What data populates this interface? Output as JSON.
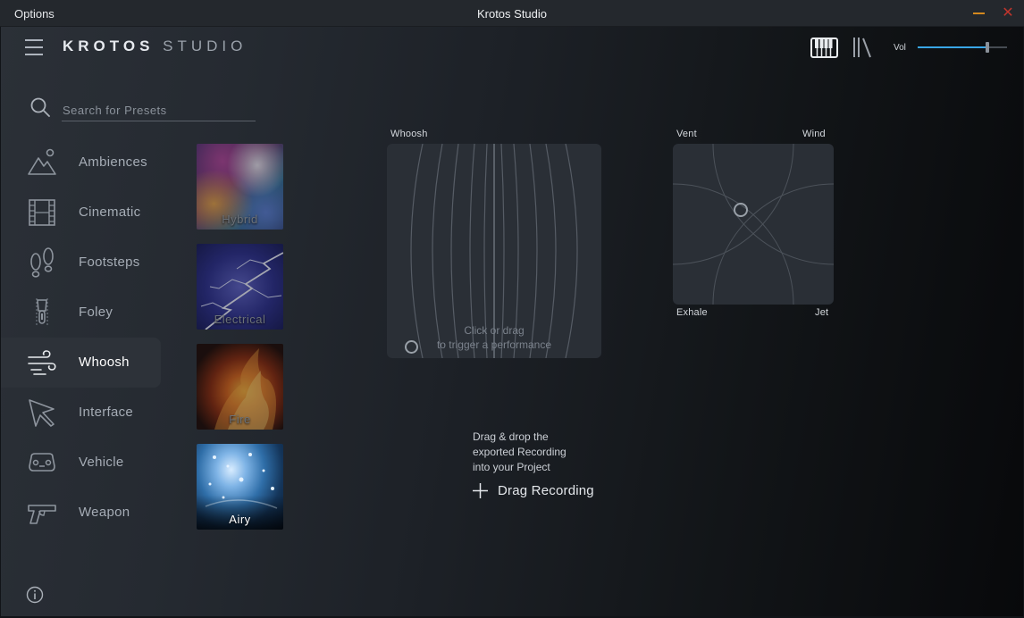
{
  "titlebar": {
    "menu_label": "Options",
    "window_title": "Krotos Studio",
    "minimize_icon": "minimize-icon",
    "close_icon": "close-icon",
    "close_glyph": "✕"
  },
  "header": {
    "logo_bold": "KROTOS",
    "logo_light": "STUDIO",
    "volume_label": "Vol",
    "volume_level": 0.78,
    "accent_color": "#39a6e6"
  },
  "search": {
    "placeholder": "Search for Presets",
    "value": ""
  },
  "categories": [
    {
      "label": "Ambiences",
      "icon": "mountain-icon",
      "active": false
    },
    {
      "label": "Cinematic",
      "icon": "film-strip-icon",
      "active": false
    },
    {
      "label": "Footsteps",
      "icon": "footprints-icon",
      "active": false
    },
    {
      "label": "Foley",
      "icon": "zipper-icon",
      "active": false
    },
    {
      "label": "Whoosh",
      "icon": "wind-icon",
      "active": true
    },
    {
      "label": "Interface",
      "icon": "cursor-icon",
      "active": false
    },
    {
      "label": "Vehicle",
      "icon": "car-icon",
      "active": false
    },
    {
      "label": "Weapon",
      "icon": "gun-icon",
      "active": false
    }
  ],
  "presets": [
    {
      "label": "Hybrid",
      "active": false
    },
    {
      "label": "Electrical",
      "active": false
    },
    {
      "label": "Fire",
      "active": false
    },
    {
      "label": "Airy",
      "active": true
    }
  ],
  "performance_pad": {
    "title": "Whoosh",
    "hint_line1": "Click or drag",
    "hint_line2": "to trigger a performance"
  },
  "xy_pad": {
    "top_left": "Vent",
    "top_right": "Wind",
    "bottom_left": "Exhale",
    "bottom_right": "Jet"
  },
  "export": {
    "line1": "Drag & drop the",
    "line2": "exported Recording",
    "line3": "into your Project",
    "button_label": "Drag Recording"
  }
}
